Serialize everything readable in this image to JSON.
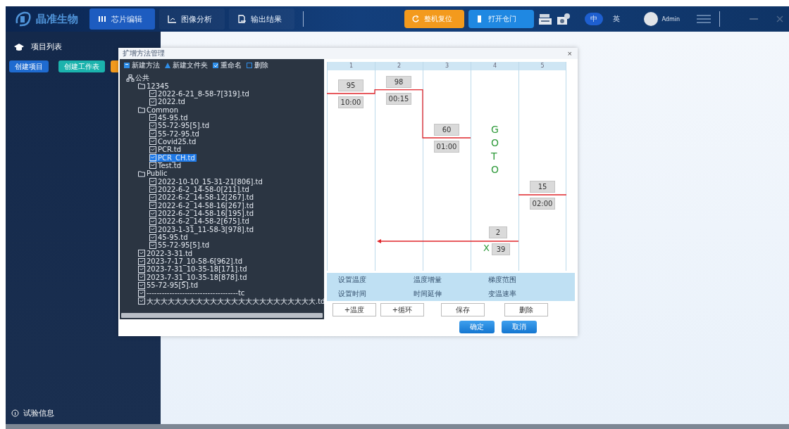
{
  "topbar": {
    "logo": "晶准生物",
    "tabs": [
      {
        "label": "芯片编辑",
        "kind": "chip",
        "selected": true
      },
      {
        "label": "图像分析",
        "kind": "image",
        "selected": false
      },
      {
        "label": "输出结果",
        "kind": "output",
        "selected": false
      }
    ],
    "actions": [
      {
        "label": "整机复位",
        "kind": "reset",
        "color": "#f39a1d"
      },
      {
        "label": "打开仓门",
        "kind": "door",
        "color": "#1f88e2"
      }
    ],
    "languages": [
      {
        "label": "中",
        "selected": true
      },
      {
        "label": "英",
        "selected": false
      }
    ],
    "user": "Admin"
  },
  "sidebar": {
    "title": "项目列表",
    "buttons": [
      {
        "label": "创建项目",
        "color": "#1f6bd0"
      },
      {
        "label": "创建工作表",
        "color": "#1bb3ad"
      },
      {
        "color": "#f39a1d"
      }
    ],
    "footer": "试验信息"
  },
  "dialog": {
    "title": "扩增方法管理",
    "close": "×",
    "tree_toolbar": [
      {
        "label": "新建方法",
        "kind": "new"
      },
      {
        "label": "新建文件夹",
        "kind": "folder"
      },
      {
        "label": "重命名",
        "kind": "rename"
      },
      {
        "label": "删除",
        "kind": "delete"
      }
    ],
    "tree": [
      {
        "label": "公共",
        "kind": "root",
        "selected": false,
        "children": [
          {
            "label": "12345",
            "kind": "folder",
            "selected": false,
            "children": [
              {
                "label": "2022-6-21_8-58-7[319].td",
                "kind": "file",
                "selected": false
              },
              {
                "label": "2022.td",
                "kind": "file",
                "selected": false
              }
            ]
          },
          {
            "label": "Common",
            "kind": "folder",
            "selected": false,
            "children": [
              {
                "label": "45-95.td",
                "kind": "file",
                "selected": false
              },
              {
                "label": "55-72-95[5].td",
                "kind": "file",
                "selected": false
              },
              {
                "label": "55-72-95.td",
                "kind": "file",
                "selected": false
              },
              {
                "label": "Covid25.td",
                "kind": "file",
                "selected": false
              },
              {
                "label": "PCR.td",
                "kind": "file",
                "selected": false
              },
              {
                "label": "PCR_CH.td",
                "kind": "file",
                "selected": true
              },
              {
                "label": "Test.td",
                "kind": "file",
                "selected": false
              }
            ]
          },
          {
            "label": "Public",
            "kind": "folder",
            "selected": false,
            "children": [
              {
                "label": "2022-10-10_15-31-21[806].td",
                "kind": "file",
                "selected": false
              },
              {
                "label": "2022-6-2_14-58-0[211].td",
                "kind": "file",
                "selected": false
              },
              {
                "label": "2022-6-2_14-58-12[267].td",
                "kind": "file",
                "selected": false
              },
              {
                "label": "2022-6-2_14-58-16[267].td",
                "kind": "file",
                "selected": false
              },
              {
                "label": "2022-6-2_14-58-16[195].td",
                "kind": "file",
                "selected": false
              },
              {
                "label": "2022-6-2_14-58-2[675].td",
                "kind": "file",
                "selected": false
              },
              {
                "label": "2023-1-31_11-58-3[978].td",
                "kind": "file",
                "selected": false
              },
              {
                "label": "45-95.td",
                "kind": "file",
                "selected": false
              },
              {
                "label": "55-72-95[5].td",
                "kind": "file",
                "selected": false
              }
            ]
          },
          {
            "label": "2022-3-31.td",
            "kind": "file",
            "selected": false
          },
          {
            "label": "2023-7-17_10-58-6[962].td",
            "kind": "file",
            "selected": false
          },
          {
            "label": "2023-7-31_10-35-18[171].td",
            "kind": "file",
            "selected": false
          },
          {
            "label": "2023-7-31_10-35-18[878].td",
            "kind": "file",
            "selected": false
          },
          {
            "label": "55-72-95[5].td",
            "kind": "file",
            "selected": false
          },
          {
            "label": "------------------------------------tc",
            "kind": "file",
            "selected": false
          },
          {
            "label": "大大大大大大大大大大大大大大大大大大大大大大大大.td",
            "kind": "file",
            "selected": false
          }
        ]
      }
    ],
    "steps": [
      {
        "column": "1",
        "kind": "temp",
        "temperature": "95",
        "time": "10:00"
      },
      {
        "column": "2",
        "kind": "temp",
        "temperature": "98",
        "time": "00:15"
      },
      {
        "column": "3",
        "kind": "temp",
        "temperature": "60",
        "time": "01:00"
      },
      {
        "column": "4",
        "kind": "goto",
        "letters": [
          "G",
          "O",
          "T",
          "O"
        ],
        "target": "2",
        "mark": "X",
        "cycles": "39"
      },
      {
        "column": "5",
        "kind": "temp",
        "temperature": "15",
        "time": "02:00"
      }
    ],
    "parameters": [
      [
        "设置温度",
        "温度增量",
        "梯度范围"
      ],
      [
        "设置时间",
        "时间延伸",
        "变温速率"
      ]
    ],
    "actions": [
      "+温度",
      "+循环",
      "保存",
      "删除"
    ],
    "confirm": [
      {
        "label": "确定"
      },
      {
        "label": "取消"
      }
    ]
  }
}
